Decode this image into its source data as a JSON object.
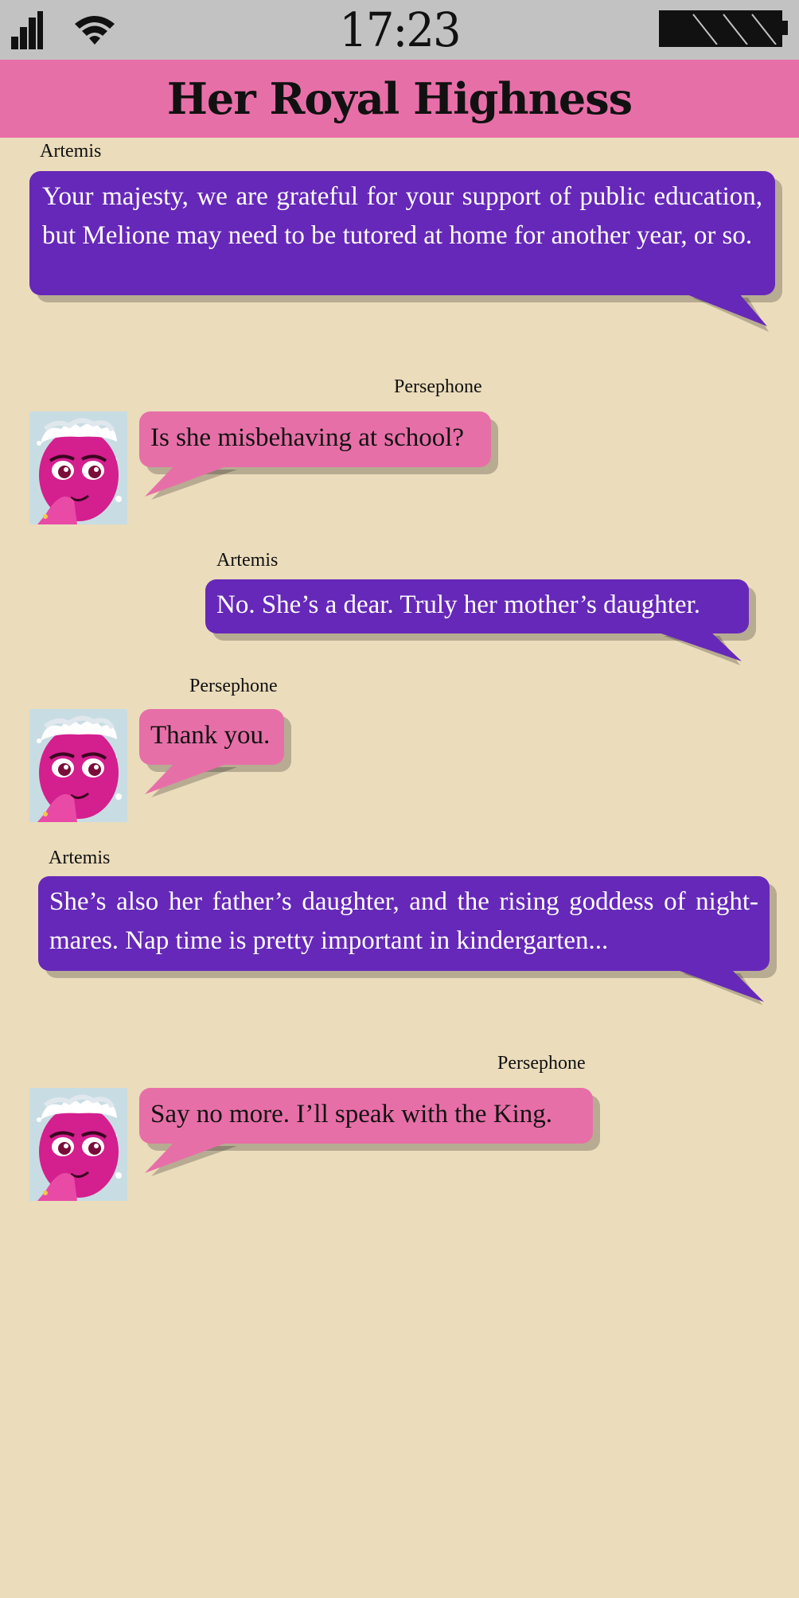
{
  "status": {
    "time": "17:23",
    "signal_icon": "cellular-signal-icon",
    "wifi_icon": "wifi-icon",
    "battery_icon": "battery-full-icon"
  },
  "header": {
    "title": "Her Royal Highness"
  },
  "colors": {
    "background": "#ebdcbb",
    "status_bar": "#c2c2c2",
    "header": "#e76fa8",
    "artemis_bubble": "#6628b8",
    "persephone_bubble": "#e76fa8"
  },
  "messages": [
    {
      "sender": "Artemis",
      "text": "Your majesty, we are grateful for your support of public education, but Melione may need to be tutored at home for another year, or so."
    },
    {
      "sender": "Persephone",
      "text": "Is she misbehaving at school?"
    },
    {
      "sender": "Artemis",
      "text": "No. She’s a dear. Truly her mother’s daughter."
    },
    {
      "sender": "Persephone",
      "text": "Thank you."
    },
    {
      "sender": "Artemis",
      "text": "She’s also her father’s daughter, and the rising goddess of night-mares. Nap time is pretty important in kindergarten..."
    },
    {
      "sender": "Persephone",
      "text": "Say no more. I’ll speak with the King."
    }
  ]
}
